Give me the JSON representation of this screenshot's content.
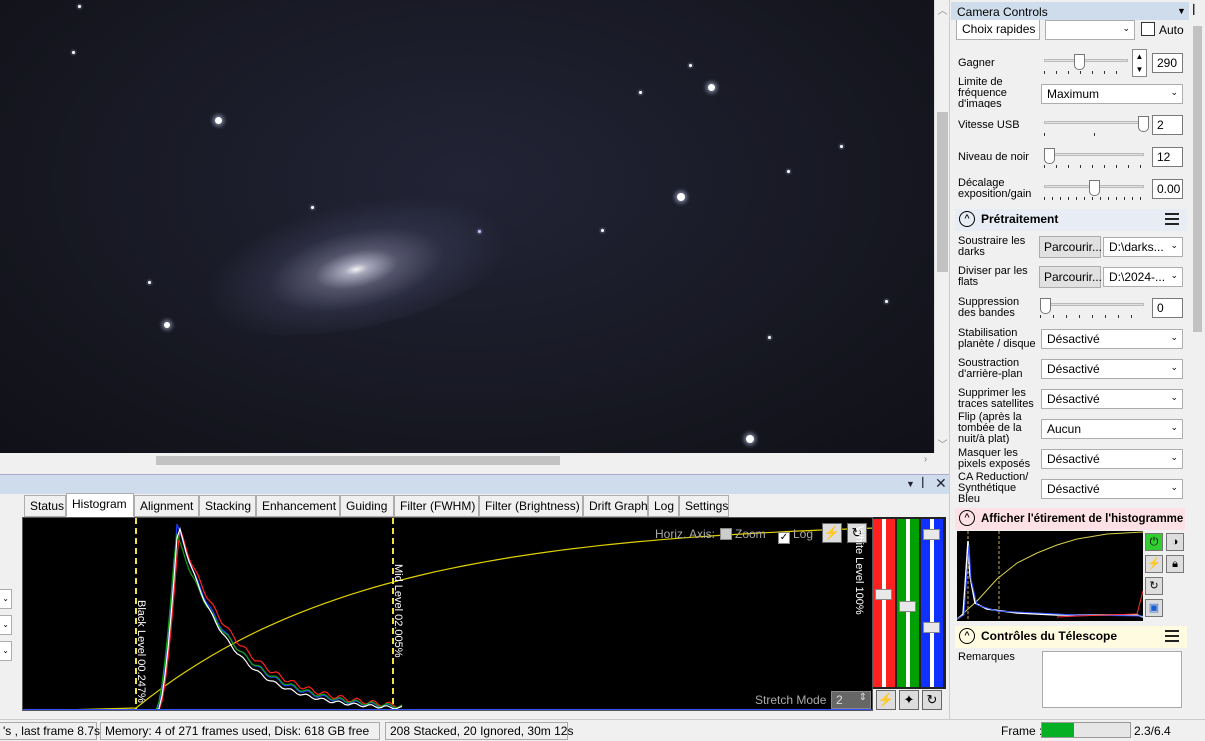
{
  "viewer": {
    "description_free": true
  },
  "bottom_panel": {
    "tabs": [
      {
        "label": "Status"
      },
      {
        "label": "Histogram"
      },
      {
        "label": "Alignment"
      },
      {
        "label": "Stacking"
      },
      {
        "label": "Enhancement"
      },
      {
        "label": "Guiding"
      },
      {
        "label": "Filter (FWHM)"
      },
      {
        "label": "Filter (Brightness)"
      },
      {
        "label": "Drift Graph"
      },
      {
        "label": "Log"
      },
      {
        "label": "Settings"
      }
    ],
    "active_tab": "Histogram",
    "histogram": {
      "horiz_axis_label": "Horiz. Axis:",
      "zoom_label": "Zoom",
      "log_label": "Log",
      "zoom_checked": false,
      "log_checked": true,
      "black_level": "Black Level  00.247%",
      "mid_level": "Mid Level  02.005%",
      "white_level": "White Level  100%",
      "stretch_mode_label": "Stretch Mode",
      "stretch_mode_value": "2"
    }
  },
  "status_bar": {
    "timing": "'s , last frame 8.7s",
    "memory": "Memory: 4 of 271 frames used, Disk: 618 GB free",
    "stacked": "208 Stacked, 20 Ignored, 30m 12s",
    "frame_label": "Frame :",
    "frame_value": "2.3/6.4",
    "frame_progress": 0.36
  },
  "camera_controls": {
    "title": "Camera Controls",
    "choix_rapides_label": "Choix rapides",
    "choix_rapides_value": "",
    "auto_label": "Auto",
    "gain_label": "Gagner",
    "gain_value": "290",
    "frame_rate_label": "Limite de fréquence d'images",
    "frame_rate_value": "Maximum",
    "usb_label": "Vitesse USB",
    "usb_value": "2",
    "black_label": "Niveau de noir",
    "black_value": "12",
    "offset_label": "Décalage exposition/gain",
    "offset_value": "0.00"
  },
  "pretraitement": {
    "title": "Prétraitement",
    "darks_label": "Soustraire les darks",
    "darks_button": "Parcourir...",
    "darks_value": "D:\\darks...",
    "flats_label": "Diviser par les flats",
    "flats_button": "Parcourir...",
    "flats_value": "D:\\2024-...",
    "bands_label": "Suppression des bandes",
    "bands_value": "0",
    "stab_label": "Stabilisation planète / disque",
    "stab_value": "Désactivé",
    "bg_label": "Soustraction d'arrière-plan",
    "bg_value": "Désactivé",
    "sat_label": "Supprimer les traces satellites",
    "sat_value": "Désactivé",
    "flip_label": "Flip (après la tombée de la nuit/à plat)",
    "flip_value": "Aucun",
    "hot_label": "Masquer les pixels exposés",
    "hot_value": "Désactivé",
    "ca_label": "CA Reduction/ Synthétique Bleu",
    "ca_value": "Désactivé"
  },
  "stretch_section": {
    "title": "Afficher l'étirement de l'histogramme"
  },
  "telescope": {
    "title": "Contrôles du Télescope",
    "remarks_label": "Remarques",
    "remarks_value": ""
  },
  "colors": {
    "accent": "#cfdcec",
    "progress": "#06b025",
    "stretch_header": "#fde1e6",
    "telescope_header": "#fffbe0"
  }
}
